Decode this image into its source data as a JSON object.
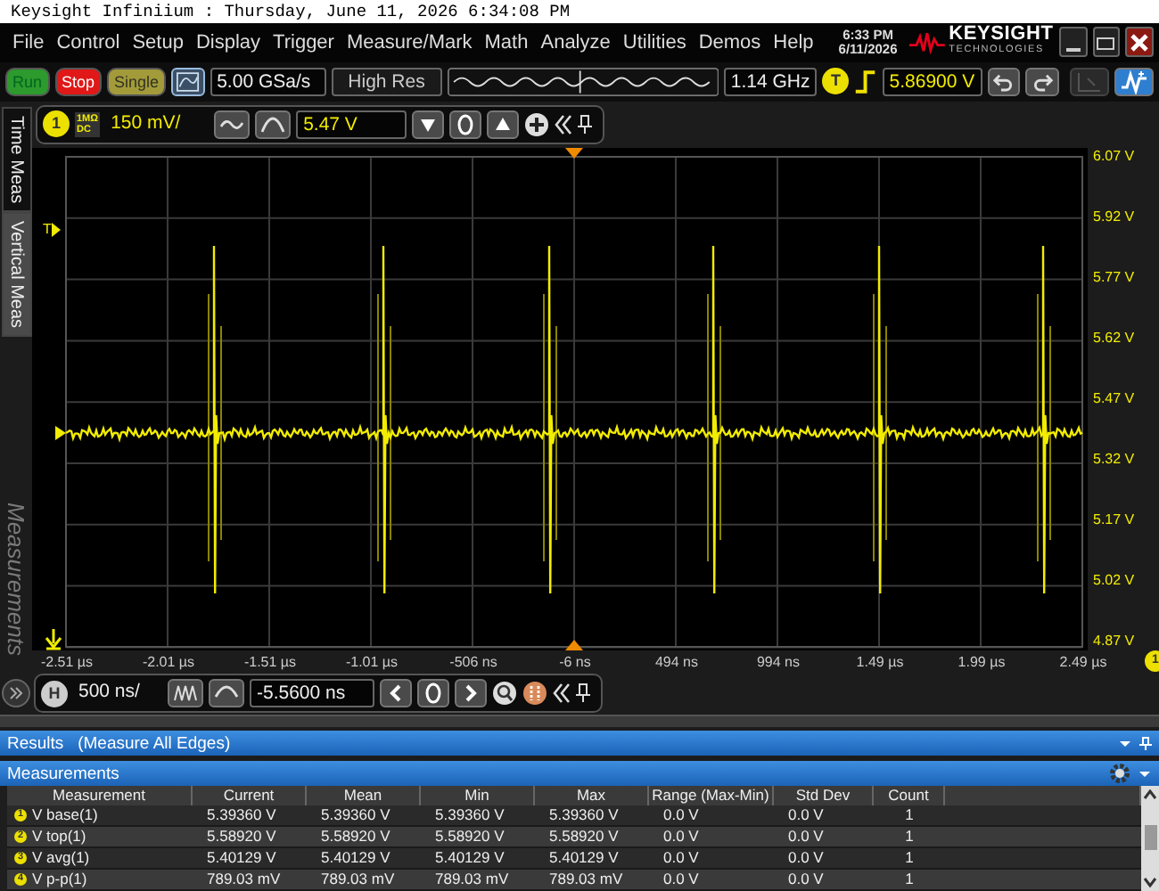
{
  "window": {
    "title": "Keysight Infiniium : Thursday, June 11, 2026 6:34:08 PM"
  },
  "menu": [
    "File",
    "Control",
    "Setup",
    "Display",
    "Trigger",
    "Measure/Mark",
    "Math",
    "Analyze",
    "Utilities",
    "Demos",
    "Help"
  ],
  "clock": {
    "time": "6:33 PM",
    "date": "6/11/2026"
  },
  "logo": {
    "name": "KEYSIGHT",
    "tagline": "TECHNOLOGIES"
  },
  "acquisition": {
    "buttons": [
      {
        "label": "Run",
        "kind": "run"
      },
      {
        "label": "Stop",
        "kind": "stop"
      },
      {
        "label": "Single",
        "kind": "single"
      }
    ],
    "sample_rate": "5.00 GSa/s",
    "mode": "High Res",
    "bandwidth": "1.14 GHz"
  },
  "trigger": {
    "badge": "T",
    "level": "5.86900 V"
  },
  "channel": {
    "badge": "1",
    "impedance": "1MΩ",
    "coupling": "DC",
    "scale": "150 mV/",
    "offset": "5.47 V"
  },
  "side_tabs": [
    {
      "label": "Time Meas",
      "selected": false
    },
    {
      "label": "Vertical Meas",
      "selected": true
    }
  ],
  "side_panel_label": "Measurements",
  "graticule": {
    "trigger_marker": "T",
    "y_labels": [
      "6.07 V",
      "5.92 V",
      "5.77 V",
      "5.62 V",
      "5.47 V",
      "5.32 V",
      "5.17 V",
      "5.02 V",
      "4.87 V"
    ],
    "x_labels": [
      "-2.51 µs",
      "-2.01 µs",
      "-1.51 µs",
      "-1.01 µs",
      "-506 ns",
      "-6 ns",
      "494 ns",
      "994 ns",
      "1.49 µs",
      "1.99 µs",
      "2.49 µs"
    ],
    "channel_badge": "1"
  },
  "timebase": {
    "badge": "H",
    "scale": "500 ns/",
    "position": "-5.5600 ns"
  },
  "results": {
    "title": "Results   (Measure All Edges)",
    "panel": "Measurements",
    "columns": [
      "Measurement",
      "Current",
      "Mean",
      "Min",
      "Max",
      "Range (Max-Min)",
      "Std Dev",
      "Count"
    ],
    "rows": [
      {
        "marker": "1",
        "cells": [
          "V base(1)",
          "5.39360 V",
          "5.39360 V",
          "5.39360 V",
          "5.39360 V",
          "0.0 V",
          "0.0 V",
          "1"
        ]
      },
      {
        "marker": "2",
        "cells": [
          "V top(1)",
          "5.58920 V",
          "5.58920 V",
          "5.58920 V",
          "5.58920 V",
          "0.0 V",
          "0.0 V",
          "1"
        ]
      },
      {
        "marker": "3",
        "cells": [
          "V avg(1)",
          "5.40129 V",
          "5.40129 V",
          "5.40129 V",
          "5.40129 V",
          "0.0 V",
          "0.0 V",
          "1"
        ]
      },
      {
        "marker": "4",
        "cells": [
          "V p-p(1)",
          "789.03 mV",
          "789.03 mV",
          "789.03 mV",
          "789.03 mV",
          "0.0 V",
          "0.0 V",
          "1"
        ]
      }
    ]
  }
}
